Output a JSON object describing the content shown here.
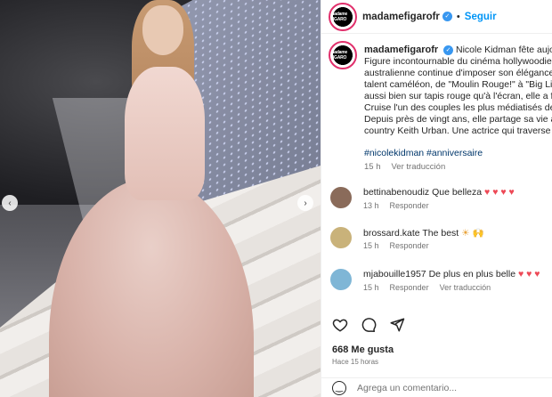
{
  "post": {
    "username": "madamefigarofr",
    "follow_label": "Seguir",
    "dot": "•",
    "verified_mark": "✓",
    "avatar_text": "madame FIGARO"
  },
  "caption": {
    "username": "madamefigarofr",
    "lines": [
      "Nicole Kidman fête aujourd'h",
      "Figure incontournable du cinéma hollywoodien, l'",
      "australienne continue d'imposer son élégance sin",
      "talent caméléon, de \"Moulin Rouge!\" à \"Big Little",
      "aussi bien sur tapis rouge qu'à l'écran, elle a form",
      "Cruise l'un des couples les plus médiatisés des an",
      "Depuis près de vingt ans, elle partage sa vie avec",
      "country Keith Urban. Une actrice qui traverse les é"
    ],
    "hashtags": "#nicolekidman #anniversaire",
    "time": "15 h",
    "translate": "Ver traducción"
  },
  "comments": [
    {
      "user": "bettinabenoudiz",
      "text": "Que belleza",
      "hearts": "♥ ♥ ♥ ♥",
      "time": "13 h",
      "reply": "Responder",
      "translate": "",
      "avatar_color": "#8a6b5a"
    },
    {
      "user": "brossard.kate",
      "text": "The best",
      "hearts": "☀ 🙌",
      "time": "15 h",
      "reply": "Responder",
      "translate": "",
      "avatar_color": "#c9b27a"
    },
    {
      "user": "mjabouille1957",
      "text": "De plus en plus belle",
      "hearts": "♥ ♥ ♥",
      "time": "15 h",
      "reply": "Responder",
      "translate": "Ver traducción",
      "avatar_color": "#7fb6d6"
    }
  ],
  "likes": "668 Me gusta",
  "ago": "Hace 15 horas",
  "add_comment_placeholder": "Agrega un comentario...",
  "nav": {
    "prev": "‹",
    "next": "›"
  },
  "colors": {
    "link": "#0095f6",
    "hashtag": "#00376b",
    "heart": "#ed4956",
    "muted": "#737373"
  }
}
